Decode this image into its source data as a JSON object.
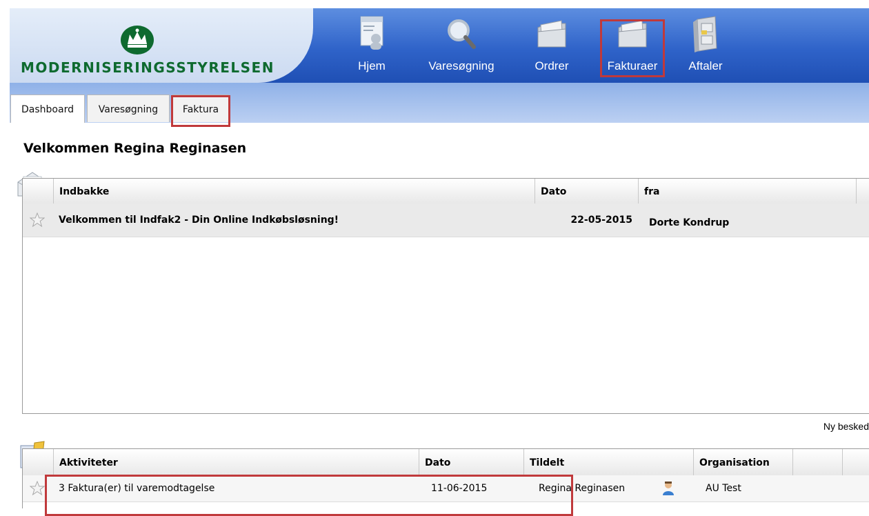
{
  "brand": {
    "logo_text": "MODERNISERINGSSTYRELSEN",
    "colors": {
      "green": "#0e6a2f",
      "nav_blue": "#2f63c9",
      "highlight_red": "#c0393b"
    }
  },
  "nav": {
    "items": [
      {
        "label": "Hjem",
        "icon": "person-card-icon"
      },
      {
        "label": "Varesøgning",
        "icon": "magnifier-icon"
      },
      {
        "label": "Ordrer",
        "icon": "folder-icon"
      },
      {
        "label": "Fakturaer",
        "icon": "folder-icon"
      },
      {
        "label": "Aftaler",
        "icon": "file-cabinet-icon"
      }
    ]
  },
  "tabs": [
    {
      "label": "Dashboard"
    },
    {
      "label": "Varesøgning"
    },
    {
      "label": "Faktura"
    }
  ],
  "welcome": "Velkommen Regina Reginasen",
  "inbox": {
    "headers": {
      "subject": "Indbakke",
      "date": "Dato",
      "from": "fra"
    },
    "rows": [
      {
        "subject": "Velkommen til Indfak2 - Din Online Indkøbsløsning!",
        "date": "22-05-2015",
        "from": "Dorte Kondrup"
      }
    ],
    "new_message": "Ny besked"
  },
  "activities": {
    "headers": {
      "activity": "Aktiviteter",
      "date": "Dato",
      "assigned": "Tildelt",
      "organisation": "Organisation"
    },
    "rows": [
      {
        "activity": "3 Faktura(er) til varemodtagelse",
        "date": "11-06-2015",
        "assigned": "Regina Reginasen",
        "organisation": "AU Test"
      }
    ]
  }
}
